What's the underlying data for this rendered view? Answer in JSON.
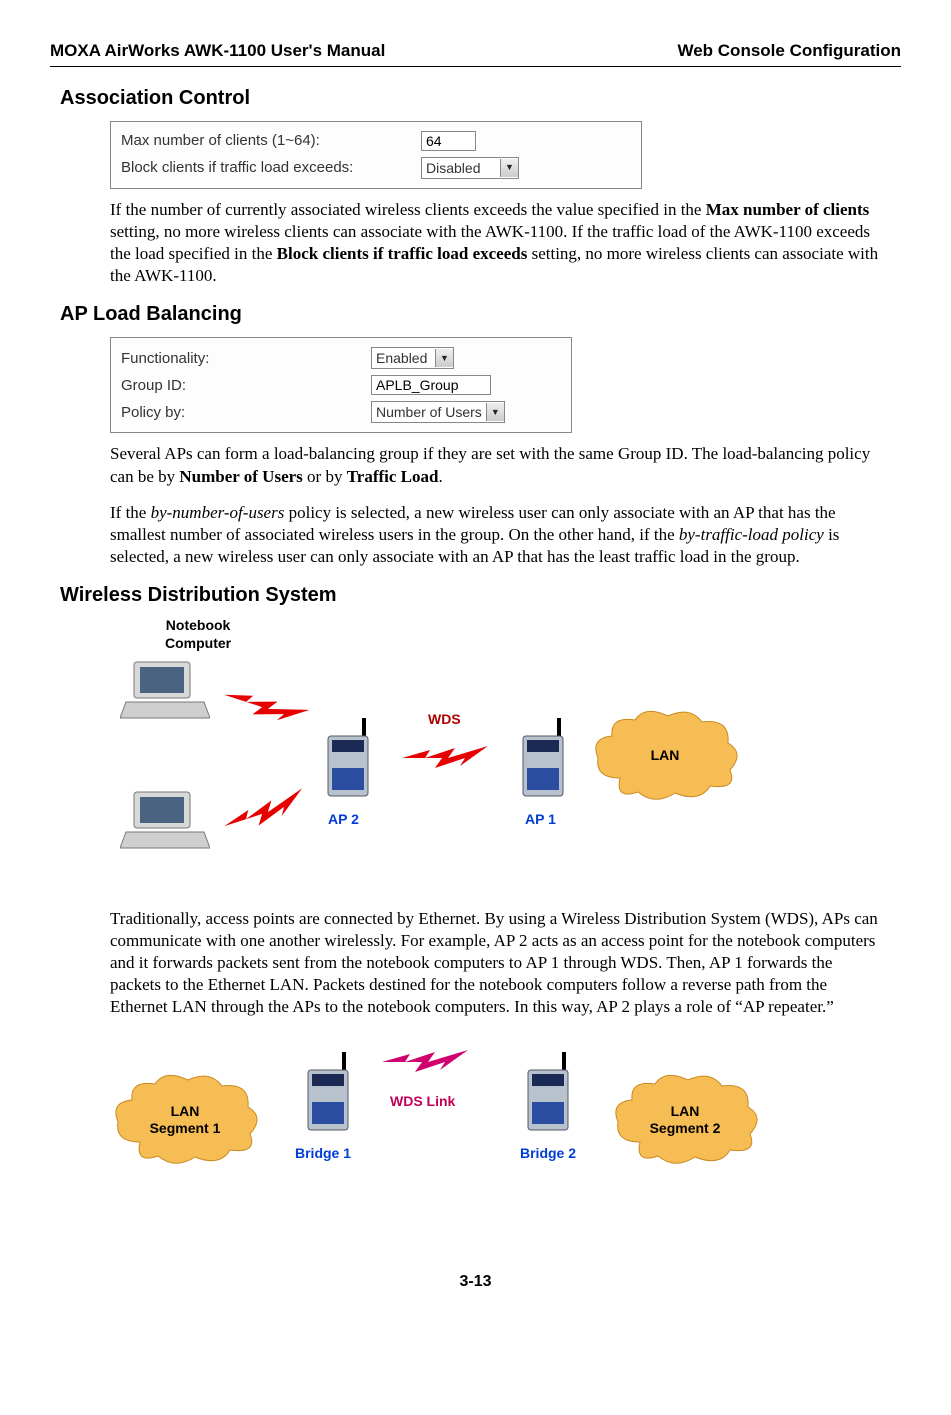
{
  "header": {
    "left": "MOXA AirWorks AWK-1100 User's Manual",
    "right": "Web Console Configuration"
  },
  "assoc": {
    "title": "Association Control",
    "row1_label": "Max number of clients (1~64):",
    "row1_value": "64",
    "row2_label": "Block clients if traffic load exceeds:",
    "row2_value": "Disabled",
    "para_pre": "If the number of currently associated wireless clients exceeds the value specified in the ",
    "para_b1": "Max number of clients",
    "para_mid1": " setting, no more wireless clients can associate with the AWK-1100. If the traffic load of the AWK-1100 exceeds the load specified in the ",
    "para_b2": "Block clients if traffic load exceeds",
    "para_end": " setting, no more wireless clients can associate with the AWK-1100."
  },
  "load": {
    "title": "AP Load Balancing",
    "row1_label": "Functionality:",
    "row1_value": "Enabled",
    "row2_label": "Group ID:",
    "row2_value": "APLB_Group",
    "row3_label": "Policy by:",
    "row3_value": "Number of Users",
    "para1_pre": "Several APs can form a load-balancing group if they are set with the same Group ID. The load-balancing policy can be by ",
    "para1_b1": "Number of Users",
    "para1_mid": " or by ",
    "para1_b2": "Traffic Load",
    "para1_end": ".",
    "para2_pre": "If the ",
    "para2_i1": "by-number-of-users",
    "para2_mid1": " policy is selected, a new wireless user can only associate with an AP that has the smallest number of associated wireless users in the group. On the other hand, if the ",
    "para2_i2": "by-traffic-load policy",
    "para2_end": " is selected, a new wireless user can only associate with an AP that has the least traffic load in the group."
  },
  "wds": {
    "title": "Wireless Distribution System",
    "notebook_label": "Notebook\nComputer",
    "wds_label": "WDS",
    "ap2_label": "AP 2",
    "ap1_label": "AP 1",
    "lan_label": "LAN",
    "para": "Traditionally, access points are connected by Ethernet. By using a Wireless Distribution System (WDS), APs can communicate with one another wirelessly. For example, AP 2 acts as an access point for the notebook computers and it forwards packets sent from the notebook computers to AP 1 through WDS. Then, AP 1 forwards the packets to the Ethernet LAN. Packets destined for the notebook computers follow a reverse path from the Ethernet LAN through the APs to the notebook computers. In this way, AP 2 plays a role of “AP repeater.”",
    "lan_seg1": "LAN\nSegment 1",
    "lan_seg2": "LAN\nSegment 2",
    "bridge1": "Bridge 1",
    "bridge2": "Bridge 2",
    "wds_link": "WDS Link"
  },
  "footer": "3-13"
}
